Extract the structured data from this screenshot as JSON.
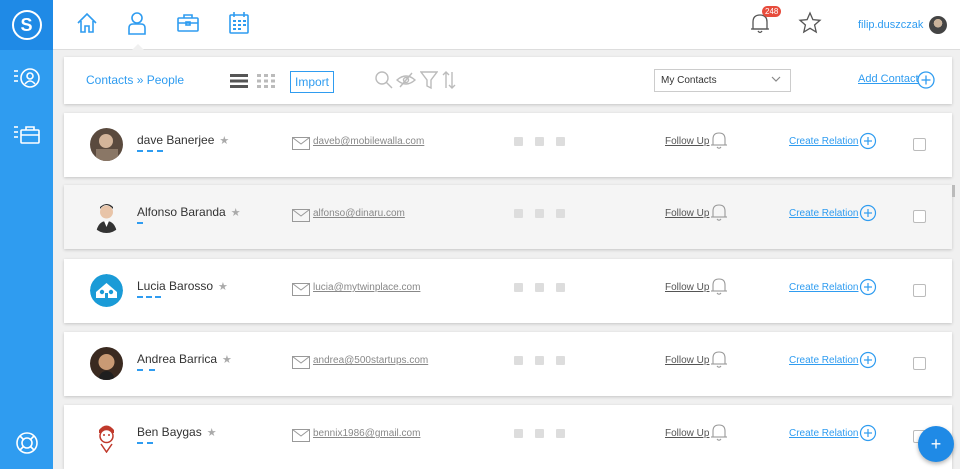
{
  "breadcrumb": {
    "contacts": "Contacts",
    "separator": "»",
    "people": "People"
  },
  "toolbar": {
    "import_label": "Import",
    "filter_select_value": "My Contacts",
    "add_contact_label": "Add Contact"
  },
  "topbar": {
    "notification_count": "248",
    "username": "filip.duszczak"
  },
  "colors": {
    "accent": "#2f9cf0",
    "rail": "#2f9cf0",
    "rail_dark": "#1f8ae6",
    "badge": "#e74c3c"
  },
  "icons": {
    "rail": [
      "logo-icon",
      "contacts-icon",
      "deals-icon",
      "help-icon"
    ],
    "nav": [
      "home-icon",
      "user-icon",
      "briefcase-icon",
      "calendar-icon"
    ],
    "tools": [
      "search-icon",
      "hide-icon",
      "filter-icon",
      "sort-icon"
    ]
  },
  "contacts": [
    {
      "name": "dave Banerjee",
      "email": "daveb@mobilewalla.com",
      "follow_label": "Follow Up",
      "relation_label": "Create Relation"
    },
    {
      "name": "Alfonso Baranda",
      "email": "alfonso@dinaru.com",
      "follow_label": "Follow Up",
      "relation_label": "Create Relation"
    },
    {
      "name": "Lucia Barosso",
      "email": "lucia@mytwinplace.com",
      "follow_label": "Follow Up",
      "relation_label": "Create Relation"
    },
    {
      "name": "Andrea Barrica",
      "email": "andrea@500startups.com",
      "follow_label": "Follow Up",
      "relation_label": "Create Relation"
    },
    {
      "name": "Ben Baygas",
      "email": "bennix1986@gmail.com",
      "follow_label": "Follow Up",
      "relation_label": "Create Relation"
    }
  ],
  "fab_label": "+"
}
